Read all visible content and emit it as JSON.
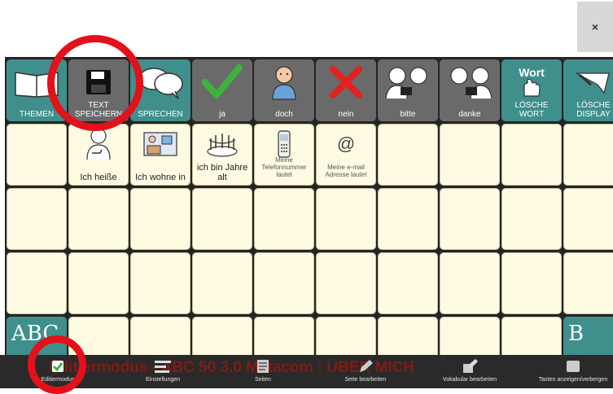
{
  "window": {
    "close_label": "×"
  },
  "toolbar_row": [
    {
      "label": "THEMEN",
      "icon": "book-icon"
    },
    {
      "label": "TEXT SPEICHERN",
      "icon": "floppy-disk-icon"
    },
    {
      "label": "SPRECHEN",
      "icon": "speech-bubble-icon"
    },
    {
      "label": "ja",
      "icon": "checkmark-icon"
    },
    {
      "label": "doch",
      "icon": "person-icon"
    },
    {
      "label": "nein",
      "icon": "cross-icon"
    },
    {
      "label": "bitte",
      "icon": "people-giving-icon"
    },
    {
      "label": "danke",
      "icon": "people-thanking-icon"
    },
    {
      "label": "LÖSCHE WORT",
      "icon": "erase-word-icon",
      "icon_text": "Wort"
    },
    {
      "label": "LÖSCHE DISPLAY",
      "icon": "erase-display-icon"
    }
  ],
  "phrase_row": [
    {
      "label": "Ich heiße",
      "icon": "person-pointing-icon"
    },
    {
      "label": "Ich wohne in",
      "icon": "house-icon"
    },
    {
      "label": "ich bin Jahre alt",
      "icon": "birthday-cake-icon"
    },
    {
      "label": "Meine Telefonnummer lautet",
      "icon": "phone-icon"
    },
    {
      "label": "Meine e-mail Adresse lautet",
      "icon": "at-sign-icon",
      "icon_text": "@"
    }
  ],
  "side_buttons": {
    "left_label": "ABC",
    "right_label": "B"
  },
  "watermark_text": "Editiermodus - ABC 50 3.0 Metacom : ÜBER MICH",
  "bottom_bar": [
    {
      "label": "Editiermodus",
      "icon": "checkbox-icon"
    },
    {
      "label": "Einstellungen",
      "icon": "settings-sliders-icon"
    },
    {
      "label": "Seiten",
      "icon": "pages-icon"
    },
    {
      "label": "Seite bearbeiten",
      "icon": "edit-page-icon"
    },
    {
      "label": "Vokabular bearbeiten",
      "icon": "edit-vocabulary-icon"
    },
    {
      "label": "Tasten anzeigen/verbergen",
      "icon": "toggle-keys-icon"
    }
  ],
  "colors": {
    "teal": "#3f8f8c",
    "dark_key": "#6a6a6a",
    "cream": "#fefbe2",
    "highlight": "#e4101a"
  }
}
